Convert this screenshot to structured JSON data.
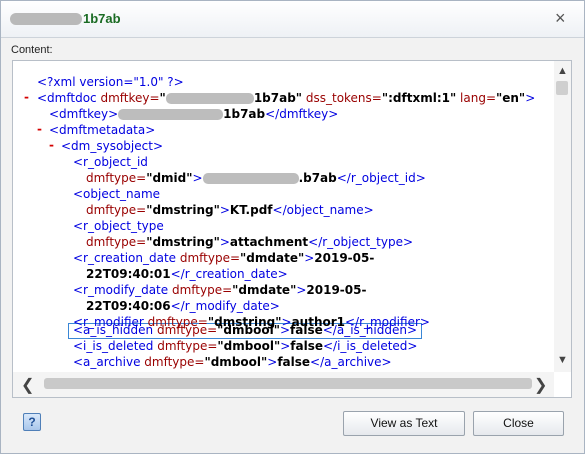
{
  "dialog": {
    "title_suffix": "1b7ab",
    "close_glyph": "×",
    "content_label": "Content:"
  },
  "xml": {
    "l0": "<?xml version=\"1.0\" ?>",
    "l1_toggle": "-",
    "l1_open": "<dmftdoc ",
    "l1_attr1": "dmftkey=",
    "l1_q": "\"",
    "l1_suffix": "1b7ab\"",
    "l1_attr2": " dss_tokens=",
    "l1_val2": "\":dftxml:1\"",
    "l1_attr3": " lang=",
    "l1_val3": "\"en\"",
    "l1_close": ">",
    "l2_open": "<dmftkey>",
    "l2_value_suffix": "1b7ab",
    "l2_close": "</dmftkey>",
    "l3_toggle": "-",
    "l3_tag": "<dmftmetadata>",
    "l4_toggle": "-",
    "l4_tag": "<dm_sysobject>",
    "l5_tag": "<r_object_id",
    "l6_attr": "dmftype=",
    "l6_val": "\"dmid\"",
    "l6_gt": ">",
    "l6_value_suffix": ".b7ab",
    "l6_close": "</r_object_id>",
    "l7_tag": "<object_name",
    "l8_attr": "dmftype=",
    "l8_val": "\"dmstring\"",
    "l8_gt": ">",
    "l8_value": "KT.pdf",
    "l8_close": "</object_name>",
    "l9_tag": "<r_object_type",
    "l10_attr": "dmftype=",
    "l10_val": "\"dmstring\"",
    "l10_gt": ">",
    "l10_value": "attachment",
    "l10_close": "</r_object_type>",
    "l11_open": "<r_creation_date ",
    "l11_attr": "dmftype=",
    "l11_val": "\"dmdate\"",
    "l11_gt": ">",
    "l11_value": "2019-05-",
    "l12_value": "22T09:40:01",
    "l12_close": "</r_creation_date>",
    "l13_open": "<r_modify_date ",
    "l13_attr": "dmftype=",
    "l13_val": "\"dmdate\"",
    "l13_gt": ">",
    "l13_value": "2019-05-",
    "l14_value": "22T09:40:06",
    "l14_close": "</r_modify_date>",
    "l15_open": "<r_modifier ",
    "l15_attr": "dmftype=",
    "l15_val": "\"dmstring\"",
    "l15_gt": ">",
    "l15_value": "author1",
    "l15_close": "</r_modifier>",
    "l16_open": "<a_is_hidden ",
    "l16_attr": "dmftype=",
    "l16_val": "\"dmbool\"",
    "l16_gt": ">",
    "l16_value": "false",
    "l16_close": "</a_is_hidden>",
    "l17_open": "<i_is_deleted ",
    "l17_attr": "dmftype=",
    "l17_val": "\"dmbool\"",
    "l17_gt": ">",
    "l17_value": "false",
    "l17_close": "</i_is_deleted>",
    "l18_open": "<a_archive ",
    "l18_attr": "dmftype=",
    "l18_val": "\"dmbool\"",
    "l18_gt": ">",
    "l18_value": "false",
    "l18_close": "</a_archive>"
  },
  "scroll": {
    "up": "▲",
    "down": "▼",
    "left": "❮",
    "right": "❯"
  },
  "footer": {
    "help": "?",
    "view_as_text": "View as Text",
    "close": "Close"
  },
  "colors": {
    "tag": "#0000e0",
    "attr": "#990000",
    "toggle": "#d40000",
    "title": "#1a6b23",
    "highlight": "#3a87d6"
  }
}
